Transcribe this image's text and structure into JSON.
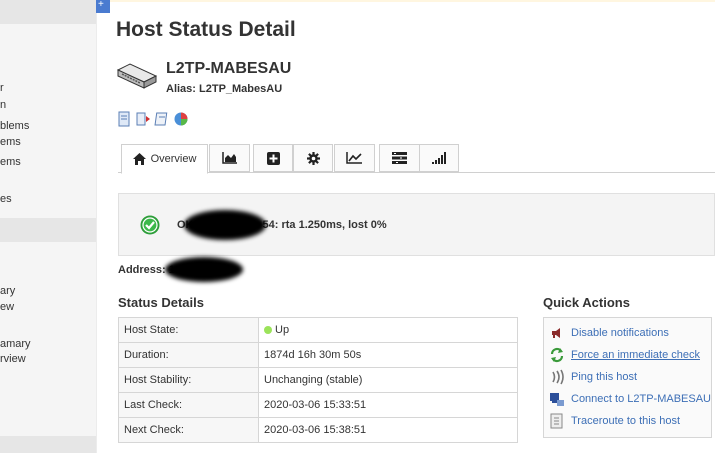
{
  "sidebar": {
    "items": [
      "r",
      "n",
      "blems",
      "ems",
      "ems",
      "es",
      "ary",
      "ew",
      "amary",
      "rview"
    ]
  },
  "corner_tab": "+",
  "page_title": "Host Status Detail",
  "host": {
    "name": "L2TP-MABESAU",
    "alias": "Alias: L2TP_MabesAU"
  },
  "tabs": [
    {
      "label": "Overview",
      "icon": "home-icon",
      "active": true
    },
    {
      "label": "",
      "icon": "area-chart-icon"
    },
    {
      "label": "",
      "icon": "plus-square-icon"
    },
    {
      "label": "",
      "icon": "gear-icon"
    },
    {
      "label": "",
      "icon": "line-chart-icon"
    },
    {
      "label": "",
      "icon": "list-icon"
    },
    {
      "label": "",
      "icon": "signal-bars-icon"
    }
  ],
  "status": {
    "prefix": "OK",
    "suffix": "54: rta 1.250ms, lost 0%",
    "address_label": "Address: 1"
  },
  "status_details": {
    "heading": "Status Details",
    "rows": [
      {
        "key": "Host State:",
        "value": "Up",
        "dot": true
      },
      {
        "key": "Duration:",
        "value": "1874d 16h 30m 50s"
      },
      {
        "key": "Host Stability:",
        "value": "Unchanging (stable)"
      },
      {
        "key": "Last Check:",
        "value": "2020-03-06 15:33:51"
      },
      {
        "key": "Next Check:",
        "value": "2020-03-06 15:38:51"
      }
    ]
  },
  "quick_actions": {
    "heading": "Quick Actions",
    "items": [
      {
        "label": "Disable notifications",
        "icon": "megaphone-mute-icon"
      },
      {
        "label": "Force an immediate check",
        "icon": "refresh-icon"
      },
      {
        "label": "Ping this host",
        "icon": "ping-icon"
      },
      {
        "label": "Connect to L2TP-MABESAU",
        "icon": "connect-icon"
      },
      {
        "label": "Traceroute to this host",
        "icon": "traceroute-icon"
      }
    ]
  },
  "colors": {
    "link": "#3d6fb6",
    "ok_green": "#2e9e3a",
    "up_dot": "#9be35a"
  }
}
